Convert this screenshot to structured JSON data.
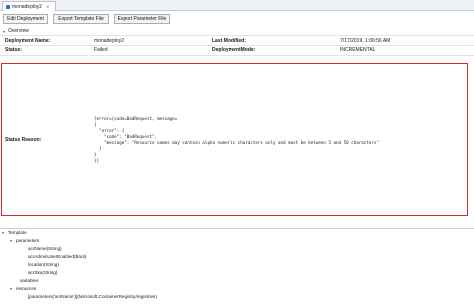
{
  "tab": {
    "title": "monadeploy2"
  },
  "toolbar": {
    "edit_label": "Edit Deployment",
    "export_template_label": "Export Template File",
    "export_parameter_label": "Export Parameter File"
  },
  "overview": {
    "title": "Overview",
    "fields": {
      "deployment_name_label": "Deployment Name:",
      "deployment_name_value": "monadeploy2",
      "status_label": "Status:",
      "status_value": "Failed",
      "last_modified_label": "Last Modified:",
      "last_modified_value": "7/17/2019, 1:06:56 AM",
      "deployment_mode_label": "DeploymentMode:",
      "deployment_mode_value": "INCREMENTAL",
      "status_reason_label": "Status Reason:",
      "status_reason_value": "[error={code=BadRequest, message=\n{\n  \"error\": {\n    \"code\": \"BadRequest\",\n    \"message\": \"Resource names may contain alpha numeric characters only and must be between 5 and 50 characters\"\n  }\n}\n}]"
    }
  },
  "tree": {
    "template_label": "Template",
    "parameters_label": "parameters",
    "parameters": [
      "acrName(String)",
      "acrAdminUserEnabled(Bool)",
      "location(String)",
      "acrSku(String)"
    ],
    "variables_label": "variables",
    "resources_label": "resources",
    "resources": [
      "[parameters('acrName')](Microsoft.ContainerRegistry/registries)"
    ]
  }
}
